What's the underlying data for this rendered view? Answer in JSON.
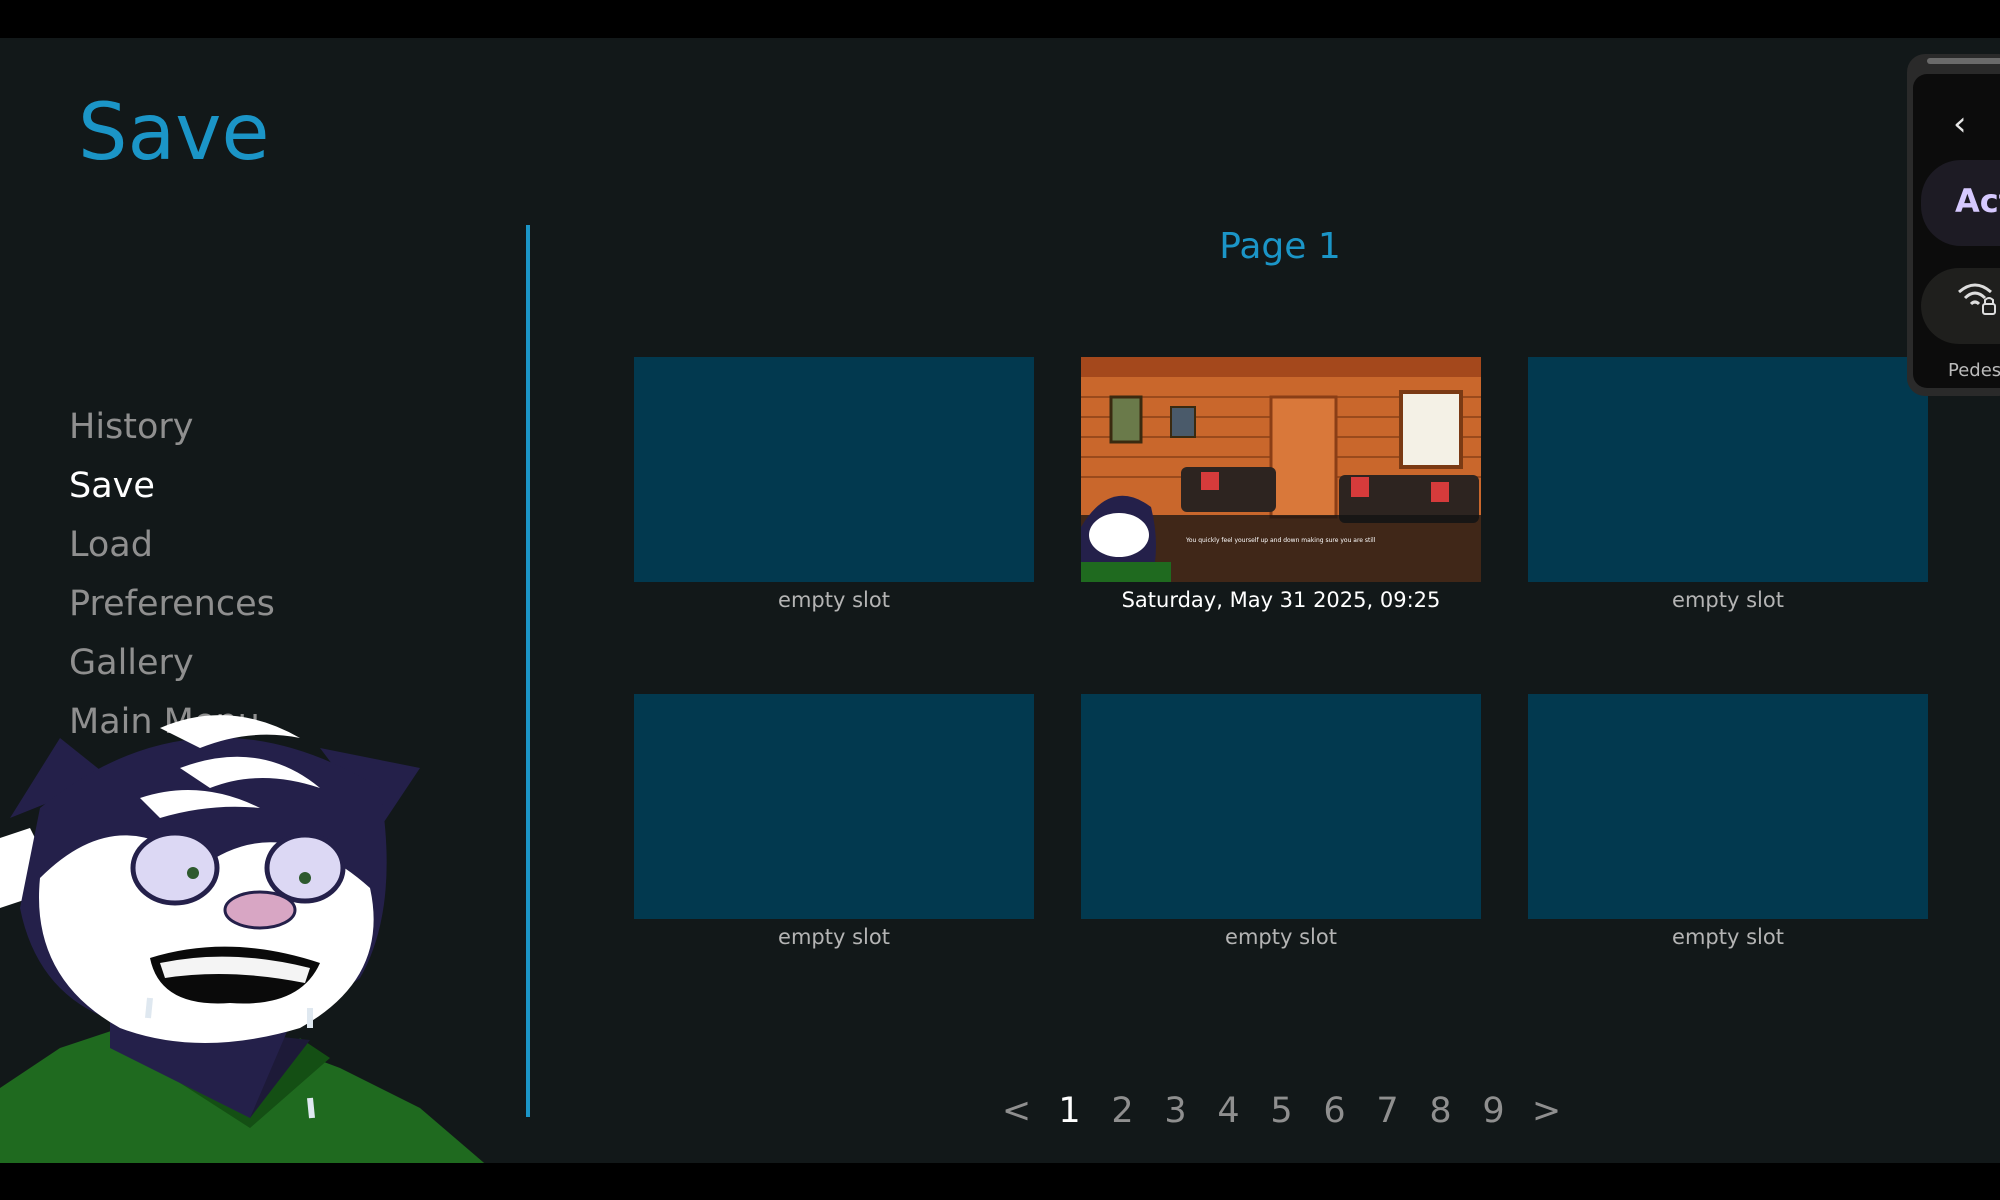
{
  "screen": {
    "title": "Save",
    "nav": [
      {
        "label": "History",
        "active": false
      },
      {
        "label": "Save",
        "active": true
      },
      {
        "label": "Load",
        "active": false
      },
      {
        "label": "Preferences",
        "active": false
      },
      {
        "label": "Gallery",
        "active": false
      },
      {
        "label": "Main Menu",
        "active": false
      }
    ],
    "page_title": "Page 1",
    "slots": [
      {
        "label": "empty slot",
        "filled": false
      },
      {
        "label": "Saturday, May 31 2025, 09:25",
        "filled": true,
        "caption": "You quickly feel yourself up and down making sure you are still"
      },
      {
        "label": "empty slot",
        "filled": false
      },
      {
        "label": "empty slot",
        "filled": false
      },
      {
        "label": "empty slot",
        "filled": false
      },
      {
        "label": "empty slot",
        "filled": false
      }
    ],
    "pager": {
      "prev": "<",
      "pages": [
        "1",
        "2",
        "3",
        "4",
        "5",
        "6",
        "7",
        "8",
        "9"
      ],
      "active_page": "1",
      "next": ">"
    }
  },
  "overlay": {
    "back_icon": "chevron-left-icon",
    "pill_text": "Act",
    "wifi_icon": "wifi-lock-icon",
    "small_text": "Pedes"
  },
  "colors": {
    "accent": "#1b95c7",
    "background": "#121819",
    "slot_empty": "#02394f",
    "nav_inactive": "#8f8f8f",
    "nav_active": "#ffffff"
  }
}
